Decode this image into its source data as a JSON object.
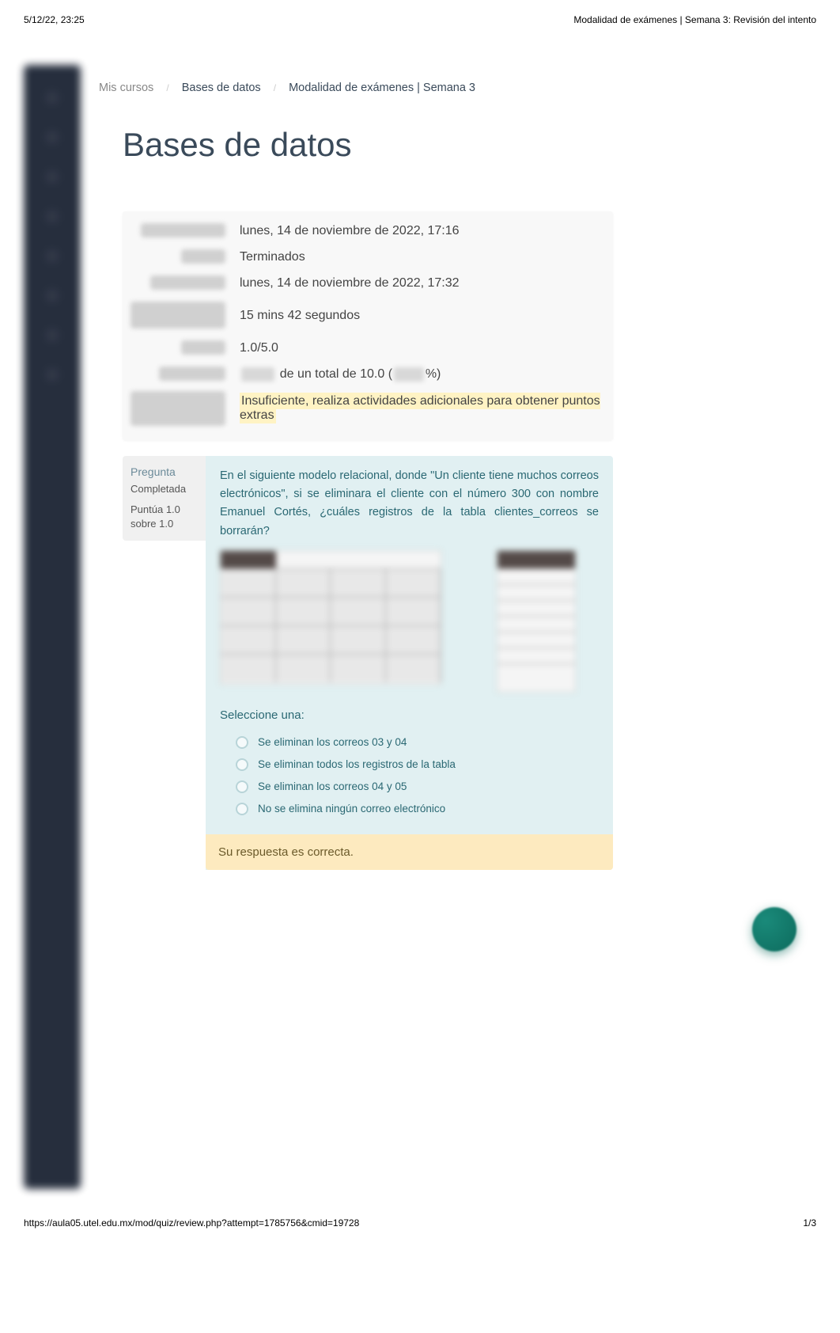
{
  "print_header": {
    "timestamp": "5/12/22, 23:25",
    "title": "Modalidad de exámenes | Semana 3: Revisión del intento"
  },
  "breadcrumb": {
    "item1": "Mis cursos",
    "item2": "Bases de datos",
    "item3": "Modalidad de exámenes | Semana 3"
  },
  "page_title": "Bases de datos",
  "summary": {
    "rows": {
      "started": {
        "label_hidden": "Comenzado en",
        "value": "lunes, 14 de noviembre de 2022, 17:16"
      },
      "state": {
        "label_hidden": "Estado",
        "value": "Terminados"
      },
      "completed": {
        "label_hidden": "Finalizado en",
        "value": "lunes, 14 de noviembre de 2022, 17:32"
      },
      "time": {
        "label_hidden": "Tiempo empleado",
        "value": "15 mins 42 segundos"
      },
      "marks": {
        "label_hidden": "Puntos",
        "value": "1.0/5.0"
      },
      "grade": {
        "label_hidden": "Calificación",
        "prefix_hidden": "2.0",
        "mid": " de un total de 10.0 (",
        "pct_hidden": "20",
        "suffix": "%)"
      },
      "feedback": {
        "label_hidden": "Comentario de retroalimentación",
        "text": " Insuficiente, realiza actividades adicionales para obtener puntos extras"
      }
    }
  },
  "question": {
    "info": {
      "label": "Pregunta",
      "state": "Completada",
      "grade_line1": "Puntúa 1.0",
      "grade_line2": "sobre 1.0"
    },
    "text": "En el siguiente modelo relacional, donde \"Un cliente tiene muchos correos electrónicos\", si se eliminara el cliente con el número 300 con nombre Emanuel Cortés, ¿cuáles registros de la tabla clientes_correos se borrarán?",
    "select_prompt": "Seleccione una:",
    "options": [
      "Se eliminan los correos 03 y 04",
      "Se eliminan todos los registros de la tabla",
      "Se eliminan los correos 04 y 05",
      "No se elimina ningún correo electrónico"
    ],
    "feedback": "Su respuesta es correcta."
  },
  "print_footer": {
    "url": "https://aula05.utel.edu.mx/mod/quiz/review.php?attempt=1785756&cmid=19728",
    "page": "1/3"
  }
}
